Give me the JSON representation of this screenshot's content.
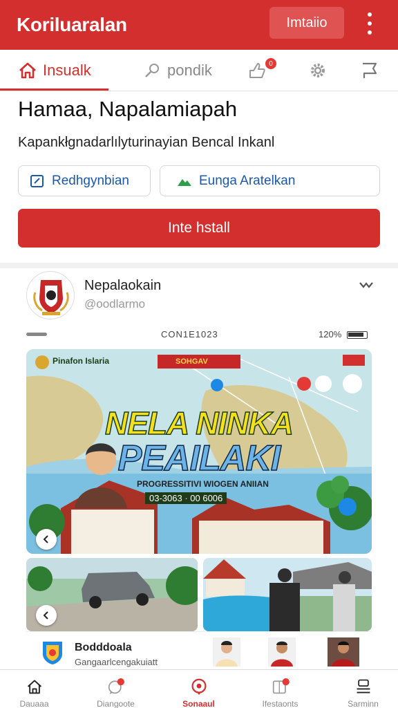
{
  "header": {
    "app_title": "Koriluaralan",
    "action_button": "Imtaiio",
    "accent_color": "#d32f2f"
  },
  "tabs": [
    {
      "label": "Insualk",
      "icon": "home-icon",
      "active": true
    },
    {
      "label": "pondik",
      "icon": "search-icon",
      "active": false
    },
    {
      "label": "",
      "icon": "thumbs-up-icon",
      "badge": "0"
    },
    {
      "label": "",
      "icon": "gear-icon"
    },
    {
      "label": "",
      "icon": "flag-icon"
    }
  ],
  "hero": {
    "title": "Hamaa, Napalamiapah",
    "subtitle": "Kapankłgnadarlılyturinayian Bencal Inkanl",
    "buttons": [
      {
        "label": "Redhgynbian",
        "icon": "calendar-edit-icon"
      },
      {
        "label": "Eunga Aratelkan",
        "icon": "mountain-icon"
      }
    ],
    "install_label": "Inte hstall"
  },
  "post": {
    "author": "Nepalaokain",
    "handle": "@oodlarmo",
    "status_bar": {
      "center": "CON1E1023",
      "battery": "120%"
    },
    "image": {
      "logo_text": "Pinafon Islaria",
      "banner_text": "SOHGAV",
      "headline_1": "NELA NINKA",
      "headline_2": "PEAILAKI",
      "tagline": "PROGRESSITIVI WIOGEN ANIIAN",
      "dates": "03-3063 · 00 6006"
    },
    "footer": {
      "name": "Bodddoala",
      "subtitle": "Gangaarlcengakuiatt"
    }
  },
  "bottom_nav": [
    {
      "label": "Dauaaa",
      "icon": "home-icon",
      "active": false
    },
    {
      "label": "Diangoote",
      "icon": "chat-icon",
      "badge": true,
      "active": false
    },
    {
      "label": "Sonaaul",
      "icon": "location-chat-icon",
      "active": true
    },
    {
      "label": "Ifestaonts",
      "icon": "book-icon",
      "badge": true,
      "active": false
    },
    {
      "label": "Sarminn",
      "icon": "profile-icon",
      "active": false
    }
  ]
}
